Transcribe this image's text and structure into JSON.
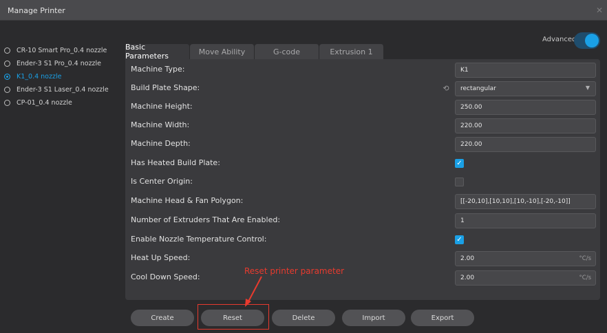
{
  "window": {
    "title": "Manage Printer"
  },
  "printers": [
    {
      "label": "CR-10 Smart Pro_0.4 nozzle",
      "selected": false
    },
    {
      "label": "Ender-3 S1 Pro_0.4 nozzle",
      "selected": false
    },
    {
      "label": "K1_0.4 nozzle",
      "selected": true
    },
    {
      "label": "Ender-3 S1 Laser_0.4 nozzle",
      "selected": false
    },
    {
      "label": "CP-01_0.4 nozzle",
      "selected": false
    }
  ],
  "advanced": {
    "label": "Advanced",
    "enabled": true
  },
  "tabs": [
    {
      "label": "Basic Parameters",
      "active": true
    },
    {
      "label": "Move Ability",
      "active": false
    },
    {
      "label": "G-code",
      "active": false
    },
    {
      "label": "Extrusion 1",
      "active": false
    }
  ],
  "params": {
    "machine_type": {
      "label": "Machine Type:",
      "value": "K1"
    },
    "build_plate_shape": {
      "label": "Build Plate Shape:",
      "value": "rectangular"
    },
    "machine_height": {
      "label": "Machine Height:",
      "value": "250.00"
    },
    "machine_width": {
      "label": "Machine Width:",
      "value": "220.00"
    },
    "machine_depth": {
      "label": "Machine Depth:",
      "value": "220.00"
    },
    "heated_build_plate": {
      "label": "Has Heated Build Plate:",
      "checked": true
    },
    "center_origin": {
      "label": "Is Center Origin:",
      "checked": false
    },
    "head_fan_polygon": {
      "label": "Machine Head & Fan Polygon:",
      "value": "[[-20,10],[10,10],[10,-10],[-20,-10]]"
    },
    "extruders_enabled": {
      "label": "Number of Extruders That Are Enabled:",
      "value": "1"
    },
    "nozzle_temp_control": {
      "label": "Enable Nozzle Temperature Control:",
      "checked": true
    },
    "heat_up_speed": {
      "label": "Heat Up Speed:",
      "value": "2.00",
      "unit": "°C/s"
    },
    "cool_down_speed": {
      "label": "Cool Down Speed:",
      "value": "2.00",
      "unit": "°C/s"
    }
  },
  "annotation": {
    "text": "Reset printer parameter",
    "color": "#e83a2e"
  },
  "actions": {
    "create": "Create",
    "reset": "Reset",
    "delete": "Delete",
    "import": "Import",
    "export": "Export"
  },
  "colors": {
    "accent": "#1aa0e6",
    "annotation": "#e83a2e"
  }
}
